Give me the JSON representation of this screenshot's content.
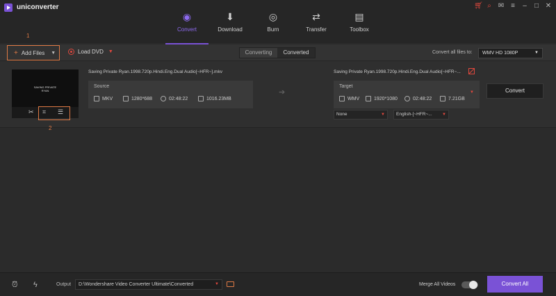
{
  "app": {
    "title": "uniconverter"
  },
  "window_controls": [
    "cart-icon",
    "search-icon",
    "email-icon",
    "menu-icon",
    "minimize-icon",
    "maximize-icon",
    "close-icon"
  ],
  "nav": [
    {
      "label": "Convert",
      "icon": "convert-icon",
      "active": true
    },
    {
      "label": "Download",
      "icon": "download-icon",
      "active": false
    },
    {
      "label": "Burn",
      "icon": "burn-icon",
      "active": false
    },
    {
      "label": "Transfer",
      "icon": "transfer-icon",
      "active": false
    },
    {
      "label": "Toolbox",
      "icon": "toolbox-icon",
      "active": false
    }
  ],
  "toolbar": {
    "add_files": "Add Files",
    "load_dvd": "Load DVD",
    "tabs": [
      "Converting",
      "Converted"
    ],
    "selected_tab": "Converted",
    "convert_all_label": "Convert all files to:",
    "convert_all_format": "WMV HD 1080P"
  },
  "annotations": {
    "one": "1",
    "two": "2"
  },
  "file": {
    "source_title": "Saving Private Ryan.1998.720p.Hindi.Eng.Dual Audio[~HFR~].mkv",
    "thumb_text": "SAVING PRIVATE RYAN",
    "source": {
      "label": "Source",
      "format": "MKV",
      "resolution": "1280*688",
      "duration": "02:48:22",
      "size": "1016.23MB"
    },
    "target_title": "Saving Private Ryan.1998.720p.Hindi.Eng.Dual Audio[~HFR~...",
    "target": {
      "label": "Target",
      "format": "WMV",
      "resolution": "1920*1080",
      "duration": "02:48:22",
      "size": "7.21GB"
    },
    "subtitle": "None",
    "audio": "English-[~HFR~...",
    "convert_button": "Convert"
  },
  "bottom": {
    "output_label": "Output",
    "output_path": "D:\\Wondershare Video Converter Ultimate\\Converted",
    "merge_label": "Merge All Videos",
    "merge_on": false,
    "convert_all_button": "Convert All"
  },
  "colors": {
    "accent": "#7a52d6",
    "highlight": "#e07a45",
    "red": "#e0483e"
  }
}
